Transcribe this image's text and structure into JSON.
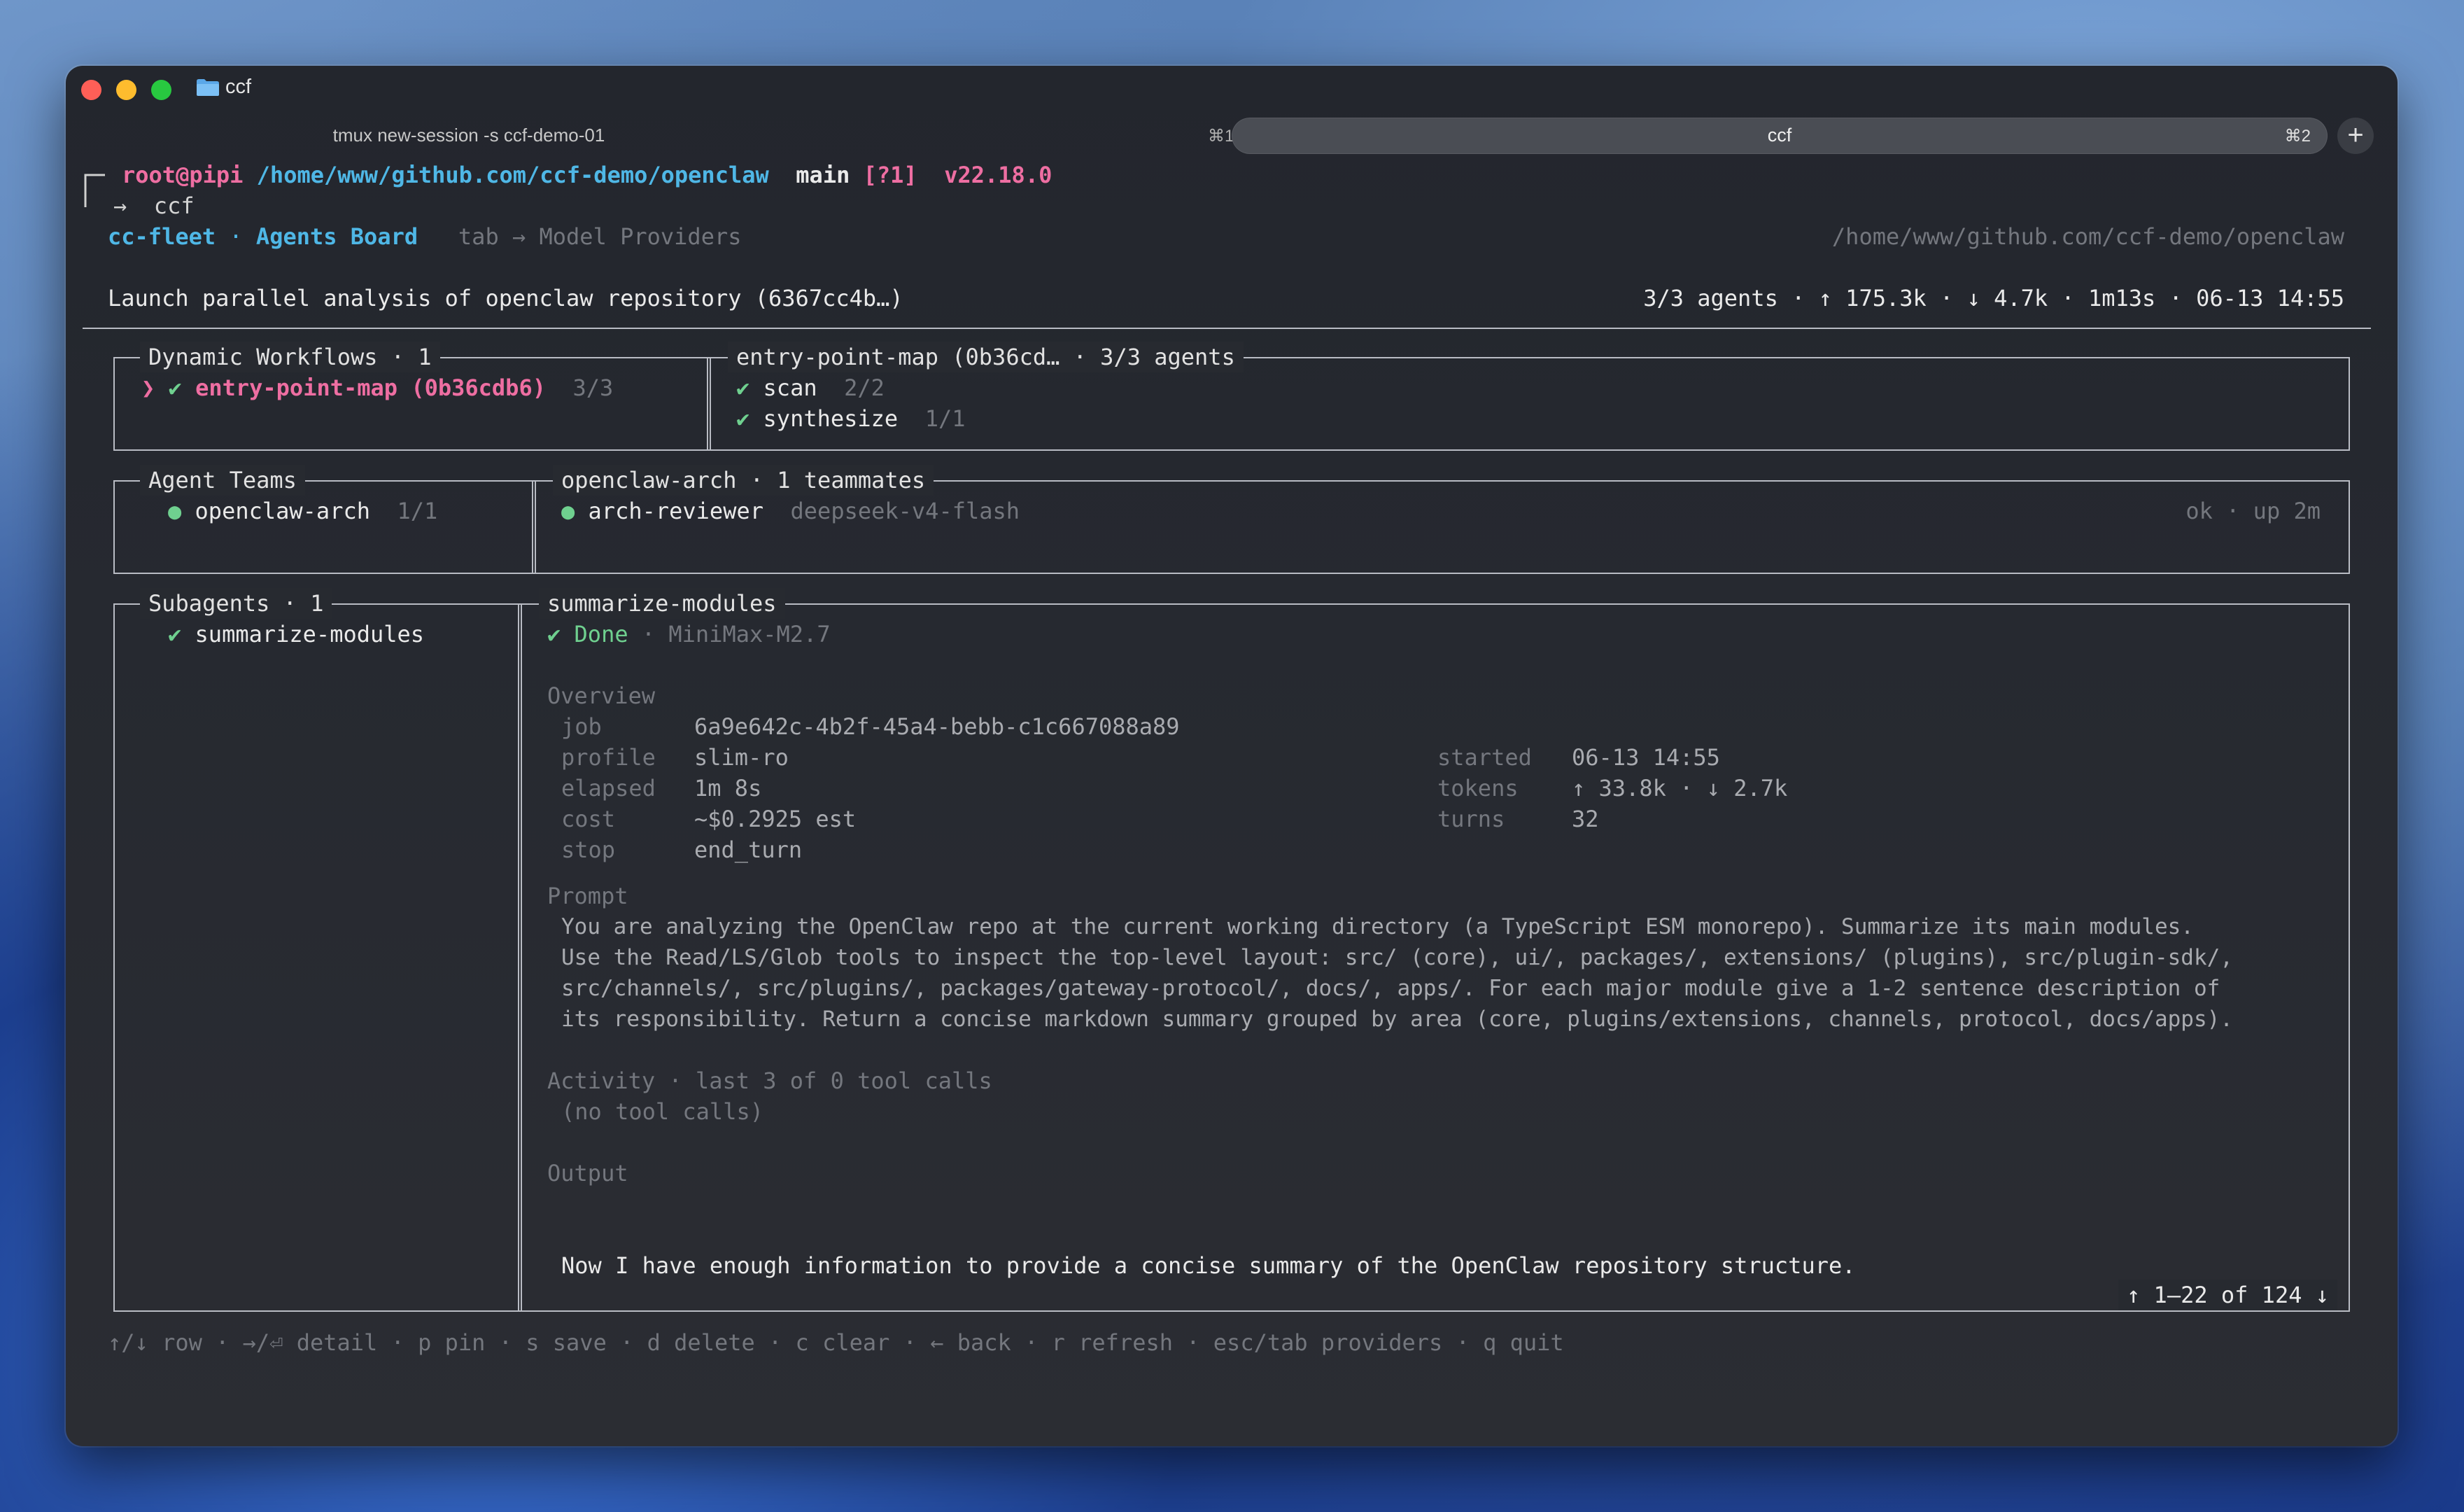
{
  "window": {
    "title": "ccf",
    "tabs": [
      {
        "label": "tmux new-session -s ccf-demo-01",
        "shortcut": "⌘1"
      },
      {
        "label": "ccf",
        "shortcut": "⌘2"
      }
    ],
    "new_tab": "+"
  },
  "prompt": {
    "user": "root@pipi",
    "path": "/home/www/github.com/ccf-demo/openclaw",
    "branch": "main",
    "git_status": "[?1]",
    "node": "v22.18.0",
    "arrow": "→",
    "command": "ccf"
  },
  "header": {
    "app": "cc-fleet",
    "sep": "·",
    "view": "Agents Board",
    "hint": "tab → Model Providers",
    "cwd": "/home/www/github.com/ccf-demo/openclaw",
    "task": "Launch parallel analysis of openclaw repository (6367cc4b…)",
    "stats": "3/3 agents · ↑ 175.3k · ↓ 4.7k · 1m13s · 06-13 14:55"
  },
  "workflows": {
    "title": "Dynamic Workflows · 1",
    "item": {
      "cursor": "❯",
      "check": "✔",
      "name": "entry-point-map (0b36cdb6)",
      "count": "3/3"
    },
    "detail_title": "entry-point-map (0b36cd… · 3/3 agents",
    "steps": [
      {
        "check": "✔",
        "name": "scan",
        "count": "2/2"
      },
      {
        "check": "✔",
        "name": "synthesize",
        "count": "1/1"
      }
    ]
  },
  "teams": {
    "title": "Agent Teams",
    "item": {
      "dot": "●",
      "name": "openclaw-arch",
      "count": "1/1"
    },
    "detail_title": "openclaw-arch · 1 teammates",
    "member": {
      "dot": "●",
      "name": "arch-reviewer",
      "model": "deepseek-v4-flash",
      "status": "ok · up 2m"
    }
  },
  "subagents": {
    "title": "Subagents · 1",
    "item": {
      "check": "✔",
      "name": "summarize-modules"
    },
    "detail_title": "summarize-modules",
    "status": {
      "check": "✔",
      "label": "Done",
      "sep": "·",
      "model": "MiniMax-M2.7"
    },
    "overview_label": "Overview",
    "overview_left": [
      {
        "key": "job",
        "value": "6a9e642c-4b2f-45a4-bebb-c1c667088a89"
      },
      {
        "key": "profile",
        "value": "slim-ro"
      },
      {
        "key": "elapsed",
        "value": "1m 8s"
      },
      {
        "key": "cost",
        "value": "~$0.2925 est"
      },
      {
        "key": "stop",
        "value": "end_turn"
      }
    ],
    "overview_right": [
      {
        "key": "started",
        "value": "06-13 14:55"
      },
      {
        "key": "tokens",
        "value": "↑ 33.8k · ↓ 2.7k"
      },
      {
        "key": "turns",
        "value": "32"
      }
    ],
    "prompt_label": "Prompt",
    "prompt_lines": [
      "You are analyzing the OpenClaw repo at the current working directory (a TypeScript ESM monorepo). Summarize its main modules.",
      "Use the Read/LS/Glob tools to inspect the top-level layout: src/ (core), ui/, packages/, extensions/ (plugins), src/plugin-sdk/,",
      "src/channels/, src/plugins/, packages/gateway-protocol/, docs/, apps/. For each major module give a 1-2 sentence description of",
      "its responsibility. Return a concise markdown summary grouped by area (core, plugins/extensions, channels, protocol, docs/apps)."
    ],
    "activity_label": "Activity · last 3 of 0 tool calls",
    "activity_empty": "(no tool calls)",
    "output_label": "Output",
    "output_line": "Now I have enough information to provide a concise summary of the OpenClaw repository structure.",
    "scroll": "↑ 1–22 of 124 ↓"
  },
  "footer": "↑/↓ row · →/⏎ detail · p pin · s save · d delete · c clear · ← back · r refresh · esc/tab providers · q quit",
  "colors": {
    "accent_pink": "#ee6ea2",
    "accent_cyan": "#4fb7e6",
    "ok_green": "#6fd08f"
  }
}
